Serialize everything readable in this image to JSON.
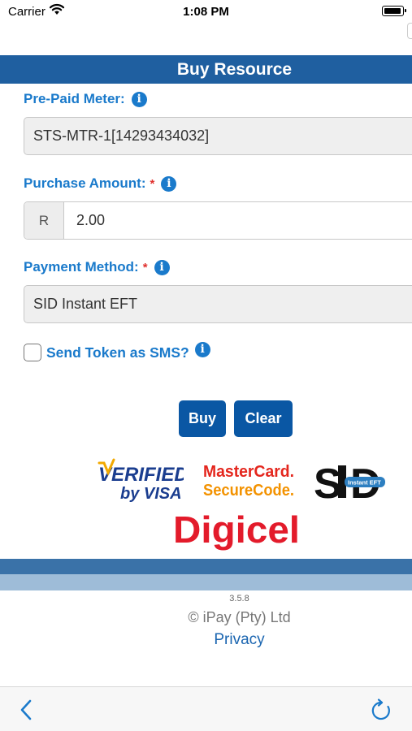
{
  "status_bar": {
    "carrier": "Carrier",
    "time": "1:08 PM"
  },
  "header": {
    "title": "Buy Resource"
  },
  "form": {
    "meter": {
      "label": "Pre-Paid Meter:",
      "value": "STS-MTR-1[14293434032]"
    },
    "amount": {
      "label": "Purchase Amount:",
      "required_mark": "*",
      "currency": "R",
      "value": "2.00"
    },
    "payment": {
      "label": "Payment Method:",
      "required_mark": "*",
      "value": "SID Instant EFT"
    },
    "sms": {
      "label": "Send Token as SMS?",
      "checked": false
    },
    "info_icon_glyph": "i"
  },
  "buttons": {
    "buy": "Buy",
    "clear": "Clear"
  },
  "logos": {
    "verified_visa": [
      "VERIFIED",
      "by VISA"
    ],
    "mastercard": [
      "MasterCard.",
      "SecureCode."
    ],
    "sid": [
      "S",
      "D",
      "Instant EFT"
    ],
    "digicel": "Digicel"
  },
  "footer": {
    "version": "3.5.8",
    "copyright": "© iPay (Pty) Ltd",
    "privacy": "Privacy"
  },
  "toolbar": {
    "back_icon": "chevron-left-icon",
    "refresh_icon": "refresh-icon"
  },
  "colors": {
    "header_bg": "#1f5fa0",
    "label_blue": "#1a7acb",
    "button_blue": "#0a57a4",
    "required_red": "#e0302d",
    "band_dark": "#3a72a8",
    "band_light": "#9ebcd8",
    "digicel_red": "#e31b2b"
  }
}
